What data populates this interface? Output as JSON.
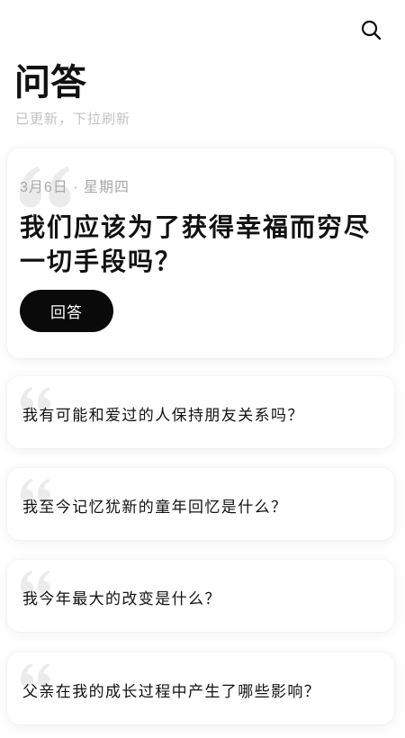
{
  "header": {
    "search_icon": "search-icon"
  },
  "page": {
    "title": "问答",
    "subtitle": "已更新，下拉刷新"
  },
  "featured": {
    "quote_icon": "quote-mark-icon",
    "date": "3月6日 · 星期四",
    "question": "我们应该为了获得幸福而穷尽一切手段吗？",
    "answer_label": "回答"
  },
  "questions": [
    {
      "quote_icon": "quote-mark-icon",
      "text": "我有可能和爱过的人保持朋友关系吗？"
    },
    {
      "quote_icon": "quote-mark-icon",
      "text": "我至今记忆犹新的童年回忆是什么？"
    },
    {
      "quote_icon": "quote-mark-icon",
      "text": "我今年最大的改变是什么？"
    },
    {
      "quote_icon": "quote-mark-icon",
      "text": "父亲在我的成长过程中产生了哪些影响？"
    }
  ],
  "colors": {
    "background": "#ffffff",
    "text": "#111111",
    "muted": "#a8a8a8",
    "subtle": "#c2c2c2",
    "quote": "#ebebeb",
    "button": "#0a0a0a",
    "button_text": "#ffffff"
  }
}
